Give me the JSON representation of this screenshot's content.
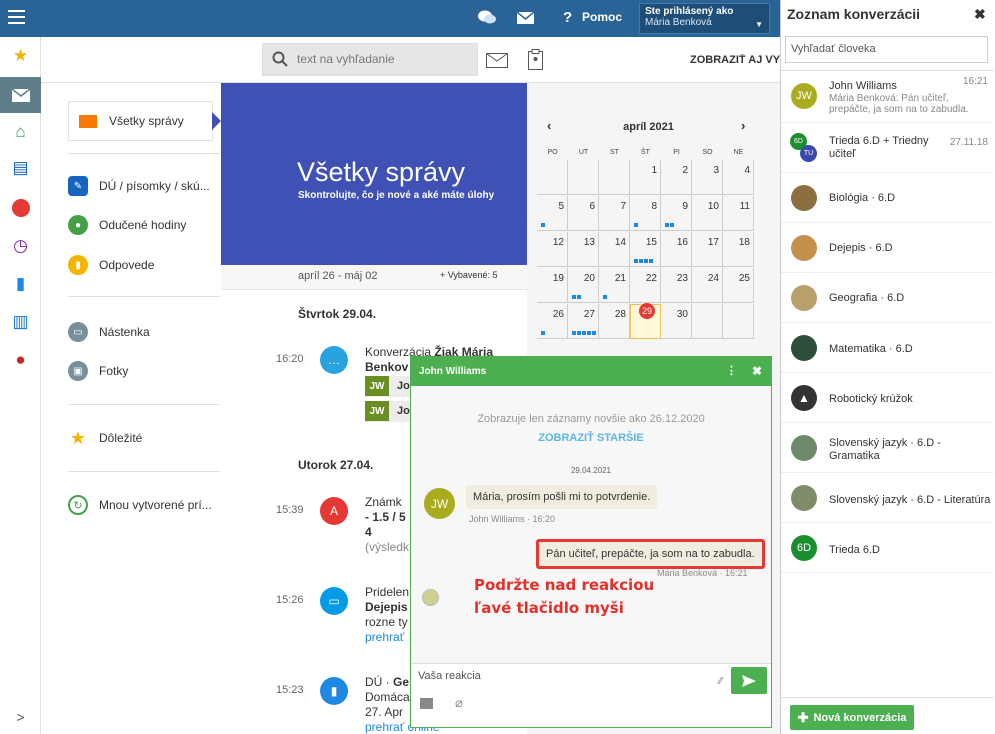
{
  "topbar": {
    "help_label": "Pomoc",
    "user_label": "Ste prihlásený ako",
    "user_name": "Mária Benková"
  },
  "search": {
    "placeholder": "text na vyhľadanie",
    "show_also": "ZOBRAZIŤ AJ VY"
  },
  "leftnav": {
    "all_messages": "Všetky správy",
    "items": [
      "DÚ / písomky / skú...",
      "Odučené hodiny",
      "Odpovede",
      "Nástenka",
      "Fotky",
      "Dôležité",
      "Mnou vytvorené prí..."
    ]
  },
  "hero": {
    "title": "Všetky správy",
    "subtitle": "Skontrolujte, čo je nové a aké máte úlohy"
  },
  "feed": {
    "range": "apríl 26 - máj 02",
    "done_label": "+ Vybavené: 5",
    "days": [
      {
        "label": "Štvrtok 29.04.",
        "messages": [
          {
            "time": "16:20",
            "line1a": "Konverzácia ",
            "line1b": "Žiak Mária",
            "line2": "Benkov",
            "jw1": "Jo",
            "jw2": "Jo"
          }
        ]
      },
      {
        "label": "Utorok 27.04.",
        "messages": [
          {
            "time": "15:39",
            "l1": "Známk",
            "l2": "- 1.5 / 5",
            "l3": "4",
            "l4": "(výsledk"
          },
          {
            "time": "15:26",
            "l1": "Pridelen",
            "l2": "Dejepis",
            "l3": "rozne ty",
            "l4": "prehrať"
          },
          {
            "time": "15:23",
            "l1a": "DÚ · ",
            "l1b": "Ge",
            "l2": "Domáca",
            "l3": "27. Apr",
            "l4": "prehrať online"
          }
        ]
      }
    ]
  },
  "calendar": {
    "title": "apríl 2021",
    "day_headers": [
      "PO",
      "UT",
      "ST",
      "ŠT",
      "PI",
      "SO",
      "NE"
    ],
    "weeks": [
      [
        "",
        "",
        "",
        "1",
        "2",
        "3",
        "4"
      ],
      [
        "5",
        "6",
        "7",
        "8",
        "9",
        "10",
        "11"
      ],
      [
        "12",
        "13",
        "14",
        "15",
        "16",
        "17",
        "18"
      ],
      [
        "19",
        "20",
        "21",
        "22",
        "23",
        "24",
        "25"
      ],
      [
        "26",
        "27",
        "28",
        "29",
        "30",
        "",
        ""
      ]
    ],
    "today": "29"
  },
  "chat": {
    "title": "John Williams",
    "notice": "Zobrazuje len záznamy novšie ako 26.12.2020",
    "show_older": "ZOBRAZIŤ STARŠIE",
    "date": "29.04.2021",
    "msg1": {
      "initials": "JW",
      "text": "Mária, prosím pošli mi to potvrdenie.",
      "meta": "John Williams · 16:20"
    },
    "msg2": {
      "text": "Pán učiteľ, prepáčte, ja som na to zabudla.",
      "meta": "Mária Benková · 16:21"
    },
    "placeholder": "Vaša reakcia",
    "annotation_line1": "Podržte nad reakciou",
    "annotation_line2": "ľavé tlačidlo myši"
  },
  "conversations": {
    "title": "Zoznam konverzácii",
    "search_placeholder": "Vyhľadať človeka",
    "new_button": "Nová konverzácia",
    "items": [
      {
        "name": "John Williams",
        "date": "16:21",
        "preview": "Mária Benková: Pán učiteľ, prepáčte, ja som na to zabudla.",
        "initials": "JW"
      },
      {
        "name": "Trieda 6.D + Triedny učiteľ",
        "date": "27.11.18",
        "initials": "6D",
        "initials2": "TU"
      },
      {
        "name": "Biológia · 6.D"
      },
      {
        "name": "Dejepis · 6.D"
      },
      {
        "name": "Geografia · 6.D"
      },
      {
        "name": "Matematika · 6.D"
      },
      {
        "name": "Robotický krúžok"
      },
      {
        "name": "Slovenský jazyk · 6.D - Gramatika"
      },
      {
        "name": "Slovenský jazyk · 6.D - Literatúra"
      },
      {
        "name": "Trieda 6.D",
        "initials": "6D"
      }
    ]
  },
  "colors": {
    "topbar": "#2a6496",
    "accent_blue": "#3f51b5",
    "green": "#4caf50",
    "annotation": "#e0312b"
  }
}
